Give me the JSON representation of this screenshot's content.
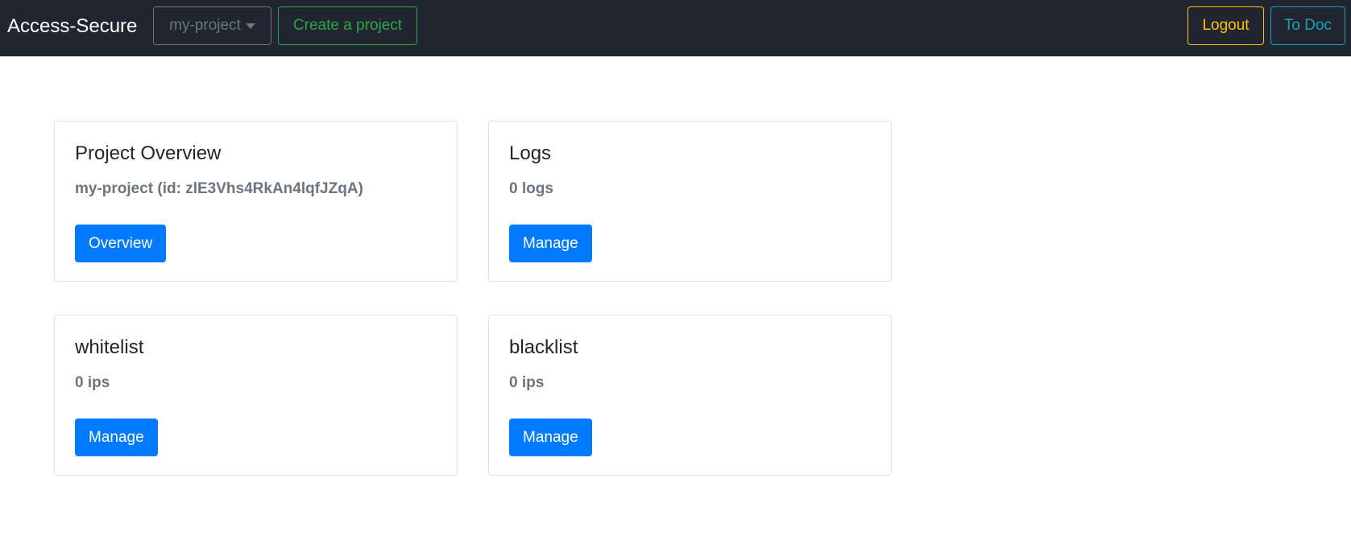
{
  "navbar": {
    "brand": "Access-Secure",
    "project_dropdown": {
      "selected": "my-project"
    },
    "create_project_label": "Create a project",
    "logout_label": "Logout",
    "doc_label": "To Doc"
  },
  "cards": [
    {
      "title": "Project Overview",
      "subtitle": "my-project (id: zlE3Vhs4RkAn4lqfJZqA)",
      "button_label": "Overview"
    },
    {
      "title": "Logs",
      "subtitle": "0 logs",
      "button_label": "Manage"
    },
    {
      "title": "whitelist",
      "subtitle": "0 ips",
      "button_label": "Manage"
    },
    {
      "title": "blacklist",
      "subtitle": "0 ips",
      "button_label": "Manage"
    }
  ],
  "colors": {
    "navbar_bg": "#202530",
    "primary": "#007bff",
    "success": "#28a745",
    "warning": "#ffc107",
    "info": "#17a2b8",
    "secondary": "#6c757d"
  },
  "icons": {
    "dropdown": "caret-down-icon"
  }
}
